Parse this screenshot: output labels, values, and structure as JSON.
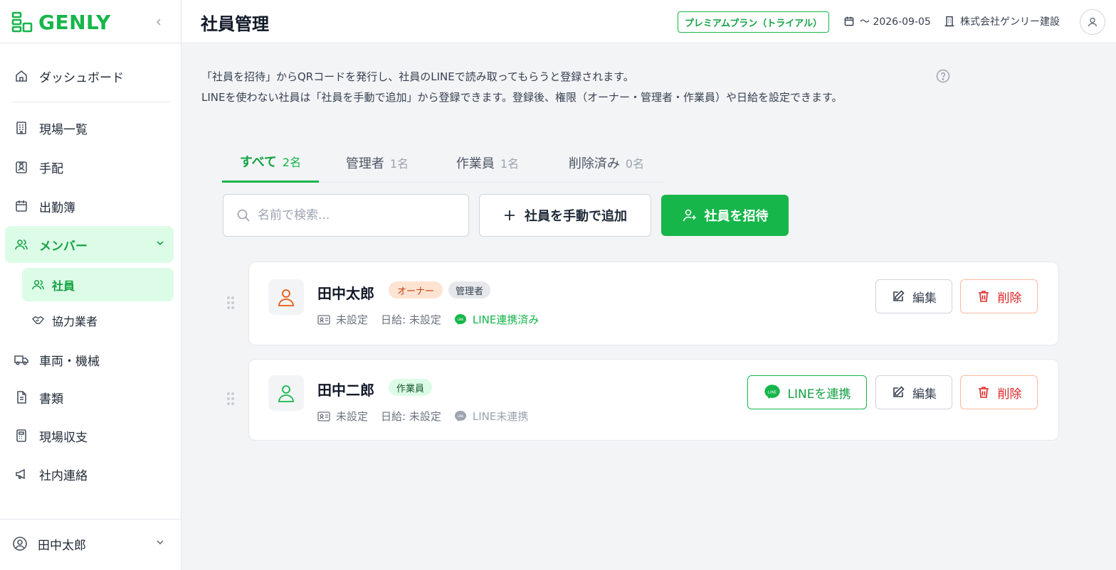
{
  "app": {
    "brand": "GENLY"
  },
  "sidebar": {
    "items": [
      {
        "label": "ダッシュボード",
        "icon": "home-icon"
      },
      {
        "label": "現場一覧",
        "icon": "building-icon"
      },
      {
        "label": "手配",
        "icon": "id-badge-icon"
      },
      {
        "label": "出勤簿",
        "icon": "calendar-icon"
      },
      {
        "label": "メンバー",
        "icon": "users-icon",
        "expanded": true
      },
      {
        "label": "車両・機械",
        "icon": "truck-icon"
      },
      {
        "label": "書類",
        "icon": "document-icon"
      },
      {
        "label": "現場収支",
        "icon": "calculator-icon"
      },
      {
        "label": "社内連絡",
        "icon": "megaphone-icon"
      }
    ],
    "sub_items": [
      {
        "label": "社員",
        "icon": "users-icon",
        "active": true
      },
      {
        "label": "協力業者",
        "icon": "handshake-icon"
      }
    ],
    "user": {
      "name": "田中太郎"
    }
  },
  "header": {
    "title": "社員管理",
    "plan": "プレミアムプラン（トライアル）",
    "expiry": "〜 2026-09-05",
    "company": "株式会社ゲンリー建設"
  },
  "main": {
    "description_line1": "「社員を招待」からQRコードを発行し、社員のLINEで読み取ってもらうと登録されます。",
    "description_line2": "LINEを使わない社員は「社員を手動で追加」から登録できます。登録後、権限（オーナー・管理者・作業員）や日給を設定できます。",
    "tabs": [
      {
        "label": "すべて",
        "count": "2名",
        "active": true
      },
      {
        "label": "管理者",
        "count": "1名"
      },
      {
        "label": "作業員",
        "count": "1名"
      },
      {
        "label": "削除済み",
        "count": "0名"
      }
    ],
    "search": {
      "placeholder": "名前で検索...",
      "value": ""
    },
    "add_manual_label": "社員を手動で追加",
    "invite_label": "社員を招待",
    "colors": {
      "accent": "#16b64a",
      "danger": "#dc2626",
      "owner": "#ea580c"
    },
    "members": [
      {
        "name": "田中太郎",
        "badges": [
          "オーナー",
          "管理者"
        ],
        "id_status": "未設定",
        "daily_wage": "日給: 未設定",
        "line_status": "LINE連携済み",
        "edit_label": "編集",
        "delete_label": "削除"
      },
      {
        "name": "田中二郎",
        "badges": [
          "作業員"
        ],
        "id_status": "未設定",
        "daily_wage": "日給: 未設定",
        "line_status": "LINE未連携",
        "link_label": "LINEを連携",
        "edit_label": "編集",
        "delete_label": "削除"
      }
    ]
  }
}
